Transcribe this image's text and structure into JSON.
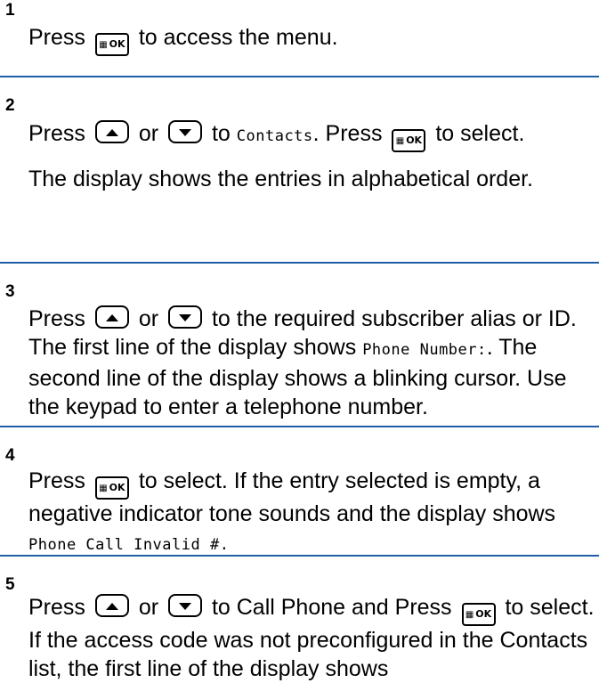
{
  "steps": [
    {
      "number": "1"
    },
    {
      "number": "2"
    },
    {
      "number": "3"
    },
    {
      "number": "4"
    },
    {
      "number": "5"
    }
  ],
  "text": {
    "press": "Press",
    "or": "or",
    "to_access_menu": "to access the menu.",
    "s2_to": "to",
    "contacts": "Contacts",
    "s2_press": ". Press",
    "s2_to_select": "to select.",
    "s2_display": "The display shows the entries in alphabetical order.",
    "s3_a": "to the required subscriber alias or ID. The first line of the display shows",
    "phone_number": "Phone Number:",
    "s3_b": ". The second line of the display shows a blinking cursor. Use the keypad to enter a telephone number.",
    "s4_a": "to select. If the entry selected is empty, a negative indicator tone sounds and the display shows",
    "phone_call_invalid": "Phone Call Invalid #.",
    "s5_a": "to Call Phone and Press",
    "s5_b": "to select. If the access code was not preconfigured in the Contacts list, the first line of the display shows"
  },
  "icons": {
    "ok_key_grid": "▦",
    "ok_key_label": "OK",
    "up_key": "up-arrow-key-icon",
    "down_key": "down-arrow-key-icon"
  },
  "colors": {
    "separator": "#1f5fa8"
  }
}
